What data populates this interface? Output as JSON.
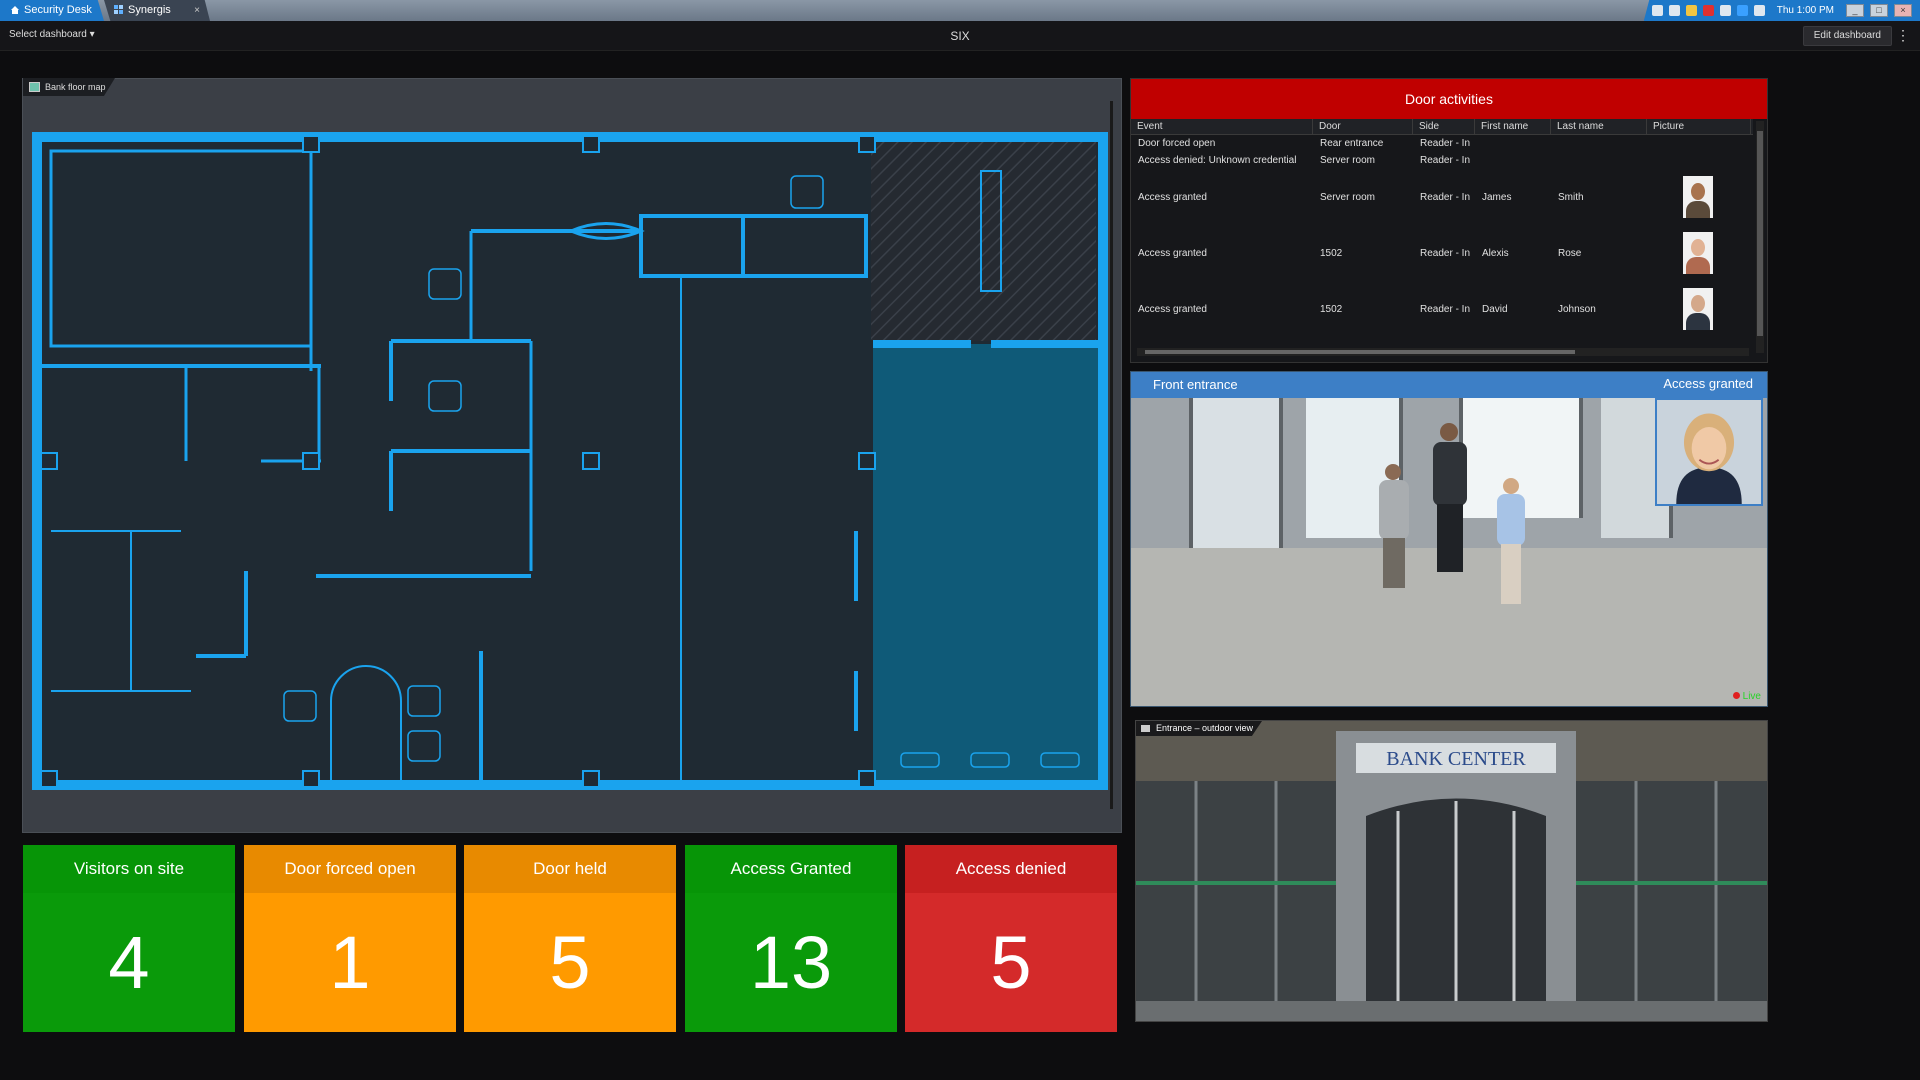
{
  "titlebar": {
    "tabs": [
      {
        "label": "Security Desk",
        "icon": "home-icon"
      },
      {
        "label": "Synergis",
        "icon": "grid-icon"
      }
    ],
    "close_glyph": "×",
    "clock": "Thu 1:00 PM"
  },
  "toolbar": {
    "select_dashboard": "Select dashboard ▾",
    "dashboard_title": "SIX",
    "edit_dashboard": "Edit dashboard",
    "more_glyph": "⋮"
  },
  "map": {
    "title": "Bank floor map",
    "colors": {
      "wall": "#1aa3ee",
      "room": "#1f2a33",
      "vault": "#0f5a78",
      "hatch": "#2a2f36"
    }
  },
  "door_activities": {
    "title": "Door activities",
    "header_color": "#c00000",
    "columns": [
      "Event",
      "Door",
      "Side",
      "First name",
      "Last name",
      "Picture"
    ],
    "rows": [
      {
        "event": "Door forced open",
        "door": "Rear entrance",
        "side": "Reader - In",
        "first": "",
        "last": "",
        "picture": false
      },
      {
        "event": "Access denied: Unknown credential",
        "door": "Server room",
        "side": "Reader - In",
        "first": "",
        "last": "",
        "picture": false
      },
      {
        "event": "Access granted",
        "door": "Server room",
        "side": "Reader - In",
        "first": "James",
        "last": "Smith",
        "picture": true
      },
      {
        "event": "Access granted",
        "door": "1502",
        "side": "Reader - In",
        "first": "Alexis",
        "last": "Rose",
        "picture": true
      },
      {
        "event": "Access granted",
        "door": "1502",
        "side": "Reader - In",
        "first": "David",
        "last": "Johnson",
        "picture": true
      }
    ]
  },
  "front_camera": {
    "title": "Front entrance",
    "status": "Access granted",
    "live": "Live"
  },
  "outdoor_camera": {
    "title": "Entrance – outdoor view",
    "sign": "BANK CENTER"
  },
  "tiles": [
    {
      "label": "Visitors on site",
      "value": "4",
      "color": "#0a9a0a",
      "head_color": "#079507"
    },
    {
      "label": "Door forced open",
      "value": "1",
      "color": "#ff9a00",
      "head_color": "#e88a00"
    },
    {
      "label": "Door held",
      "value": "5",
      "color": "#ff9a00",
      "head_color": "#e88a00"
    },
    {
      "label": "Access Granted",
      "value": "13",
      "color": "#0a9a0a",
      "head_color": "#079507"
    },
    {
      "label": "Access denied",
      "value": "5",
      "color": "#d42a2a",
      "head_color": "#c62020"
    }
  ]
}
